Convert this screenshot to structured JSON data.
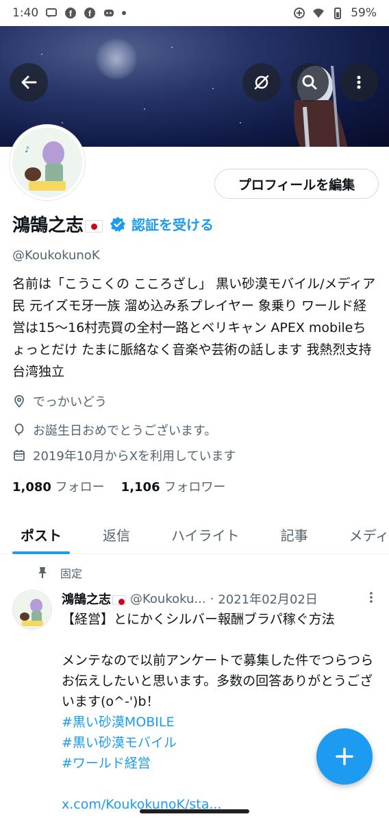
{
  "status_bar": {
    "time": "1:40",
    "battery_percent": "59%"
  },
  "header": {
    "back_icon": "arrow-left-icon",
    "grok_icon": "grok-icon",
    "search_icon": "search-icon",
    "more_icon": "more-vertical-icon"
  },
  "profile": {
    "edit_button_label": "プロフィールを編集",
    "display_name": "鴻鵠之志",
    "verify_label": "認証を受ける",
    "handle": "@KoukokunoK",
    "bio": "名前は「こうこくの こころざし」 黒い砂漠モバイル/メディア民 元イズモ牙一族 溜め込み系プレイヤー 象乗り ワールド経営は15〜16村売買の全村一路とベリキャン APEX mobileちょっとだけ たまに脈絡なく音楽や芸術の話します 我熱烈支持台湾独立",
    "location": "でっかいどう",
    "birthday": "お誕生日おめでとうございます。",
    "joined": "2019年10月からXを利用しています",
    "following_count": "1,080",
    "following_label": "フォロー",
    "followers_count": "1,106",
    "followers_label": "フォロワー"
  },
  "tabs": [
    {
      "label": "ポスト"
    },
    {
      "label": "返信"
    },
    {
      "label": "ハイライト"
    },
    {
      "label": "記事"
    },
    {
      "label": "メディア"
    }
  ],
  "post": {
    "pinned_label": "固定",
    "author_name": "鴻鵠之志",
    "author_handle": "@Koukoku...",
    "separator": "·",
    "date": "2021年02月02日",
    "title_line": "【経営】とにかくシルバー報酬ブラパ稼ぐ方法",
    "body": "メンテなので以前アンケートで募集した件でつらつらお伝えしたいと思います。多数の回答ありがとうございます(o^-')b！",
    "hashtags": [
      "#黒い砂漠MOBILE",
      "#黒い砂漠モバイル",
      "#ワールド経営"
    ],
    "link": "x.com/KoukokunoK/sta..."
  },
  "colors": {
    "accent": "#1d9bf0",
    "text_primary": "#0f1419",
    "text_secondary": "#536471"
  }
}
